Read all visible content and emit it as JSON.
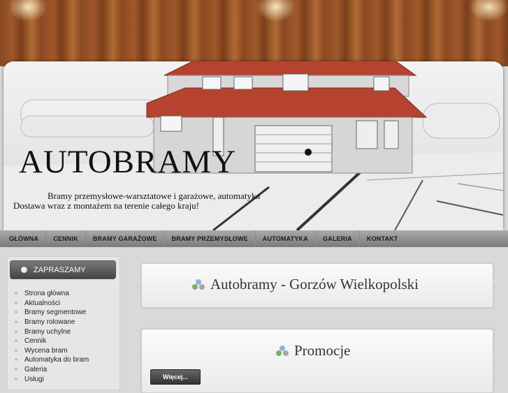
{
  "header": {
    "logo_text": "AUTOBRAMY",
    "tagline_1": "Bramy przemysłowe-warsztatowe i garażowe, automatyka",
    "tagline_2": "Dostawa wraz z montażem na terenie całego kraju!"
  },
  "nav": {
    "items": [
      "GŁÓWNA",
      "CENNIK",
      "BRAMY GARAŻOWE",
      "BRAMY PRZEMYSŁOWE",
      "AUTOMATYKA",
      "GALERIA",
      "KONTAKT"
    ]
  },
  "sidebar": {
    "title": "ZAPRASZAMY",
    "items": [
      "Strona główna",
      "Aktualności",
      "Bramy segmentowe",
      "Bramy rolowane",
      "Bramy uchylne",
      "Cennik",
      "Wycena bram",
      "Automatyka do bram",
      "Galeria",
      "Usługi"
    ]
  },
  "main": {
    "title": "Autobramy - Gorzów Wielkopolski",
    "promo_title": "Promocje",
    "more_button": "Więcej..."
  },
  "icons": {
    "box_icon": "molecule-icon",
    "list_bullet": "double-chevron-right-icon"
  },
  "colors": {
    "roof": "#b5432f",
    "nav": "#8f8f8f",
    "sidebar_head": "#555555"
  }
}
